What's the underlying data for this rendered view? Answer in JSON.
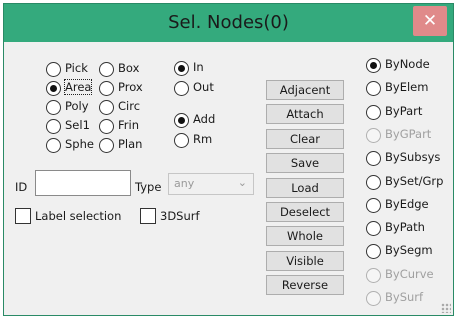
{
  "window": {
    "title": "Sel. Nodes(0)",
    "close_glyph": "✕"
  },
  "pick_modes": [
    {
      "label": "Pick",
      "selected": false,
      "focused": false
    },
    {
      "label": "Box",
      "selected": false,
      "focused": false
    },
    {
      "label": "Area",
      "selected": true,
      "focused": true
    },
    {
      "label": "Prox",
      "selected": false,
      "focused": false
    },
    {
      "label": "Poly",
      "selected": false,
      "focused": false
    },
    {
      "label": "Circ",
      "selected": false,
      "focused": false
    },
    {
      "label": "Sel1",
      "selected": false,
      "focused": false
    },
    {
      "label": "Frin",
      "selected": false,
      "focused": false
    },
    {
      "label": "Sphe",
      "selected": false,
      "focused": false
    },
    {
      "label": "Plan",
      "selected": false,
      "focused": false
    }
  ],
  "region": [
    {
      "label": "In",
      "selected": true
    },
    {
      "label": "Out",
      "selected": false
    }
  ],
  "action": [
    {
      "label": "Add",
      "selected": true
    },
    {
      "label": "Rm",
      "selected": false
    }
  ],
  "buttons": [
    "Adjacent",
    "Attach",
    "Clear",
    "Save",
    "Load",
    "Deselect",
    "Whole",
    "Visible",
    "Reverse"
  ],
  "by_options": [
    {
      "label": "ByNode",
      "selected": true,
      "disabled": false
    },
    {
      "label": "ByElem",
      "selected": false,
      "disabled": false
    },
    {
      "label": "ByPart",
      "selected": false,
      "disabled": false
    },
    {
      "label": "ByGPart",
      "selected": false,
      "disabled": true
    },
    {
      "label": "BySubsys",
      "selected": false,
      "disabled": false
    },
    {
      "label": "BySet/Grp",
      "selected": false,
      "disabled": false
    },
    {
      "label": "ByEdge",
      "selected": false,
      "disabled": false
    },
    {
      "label": "ByPath",
      "selected": false,
      "disabled": false
    },
    {
      "label": "BySegm",
      "selected": false,
      "disabled": false
    },
    {
      "label": "ByCurve",
      "selected": false,
      "disabled": true
    },
    {
      "label": "BySurf",
      "selected": false,
      "disabled": true
    }
  ],
  "id_field": {
    "label": "ID",
    "value": ""
  },
  "type_field": {
    "label": "Type",
    "value": "any",
    "disabled": true
  },
  "checks": [
    {
      "label": "Label selection",
      "checked": false
    },
    {
      "label": "3DSurf",
      "checked": false
    }
  ]
}
